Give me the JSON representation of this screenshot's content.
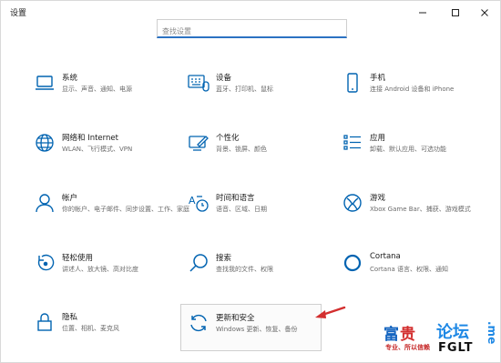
{
  "window": {
    "title": "设置",
    "minimize_icon": "minimize-icon",
    "maximize_icon": "maximize-icon",
    "close_icon": "close-icon"
  },
  "search": {
    "placeholder": "查找设置"
  },
  "tiles": [
    {
      "name": "系统",
      "desc": "显示、声音、通知、电源",
      "icon": "laptop-icon"
    },
    {
      "name": "设备",
      "desc": "蓝牙、打印机、鼠标",
      "icon": "keyboard-icon"
    },
    {
      "name": "手机",
      "desc": "连接 Android 设备和 iPhone",
      "icon": "phone-icon"
    },
    {
      "name": "网络和 Internet",
      "desc": "WLAN、飞行模式、VPN",
      "icon": "globe-icon"
    },
    {
      "name": "个性化",
      "desc": "背景、锁屏、颜色",
      "icon": "paint-icon"
    },
    {
      "name": "应用",
      "desc": "卸载、默认应用、可选功能",
      "icon": "apps-icon"
    },
    {
      "name": "帐户",
      "desc": "你的帐户、电子邮件、同步设置、工作、家庭",
      "icon": "person-icon"
    },
    {
      "name": "时间和语言",
      "desc": "语音、区域、日期",
      "icon": "time-language-icon"
    },
    {
      "name": "游戏",
      "desc": "Xbox Game Bar、捕获、游戏模式",
      "icon": "xbox-icon"
    },
    {
      "name": "轻松使用",
      "desc": "讲述人、放大镜、高对比度",
      "icon": "ease-of-access-icon"
    },
    {
      "name": "搜索",
      "desc": "查找我的文件、权限",
      "icon": "search-icon"
    },
    {
      "name": "Cortana",
      "desc": "Cortana 语言、权限、通知",
      "icon": "cortana-icon"
    },
    {
      "name": "隐私",
      "desc": "位置、相机、麦克风",
      "icon": "lock-icon"
    },
    {
      "name": "更新和安全",
      "desc": "Windows 更新、恢复、备份",
      "icon": "update-icon"
    }
  ],
  "watermark": {
    "logo_left": "富",
    "logo_mid": "贵",
    "logo_right": "论坛",
    "slogan": "专业、所以信赖",
    "site": "FGLT",
    "suffix": ".me"
  },
  "colors": {
    "accent": "#0063b1",
    "search_underline": "#2b72c2",
    "arrow": "#d32f2f"
  }
}
